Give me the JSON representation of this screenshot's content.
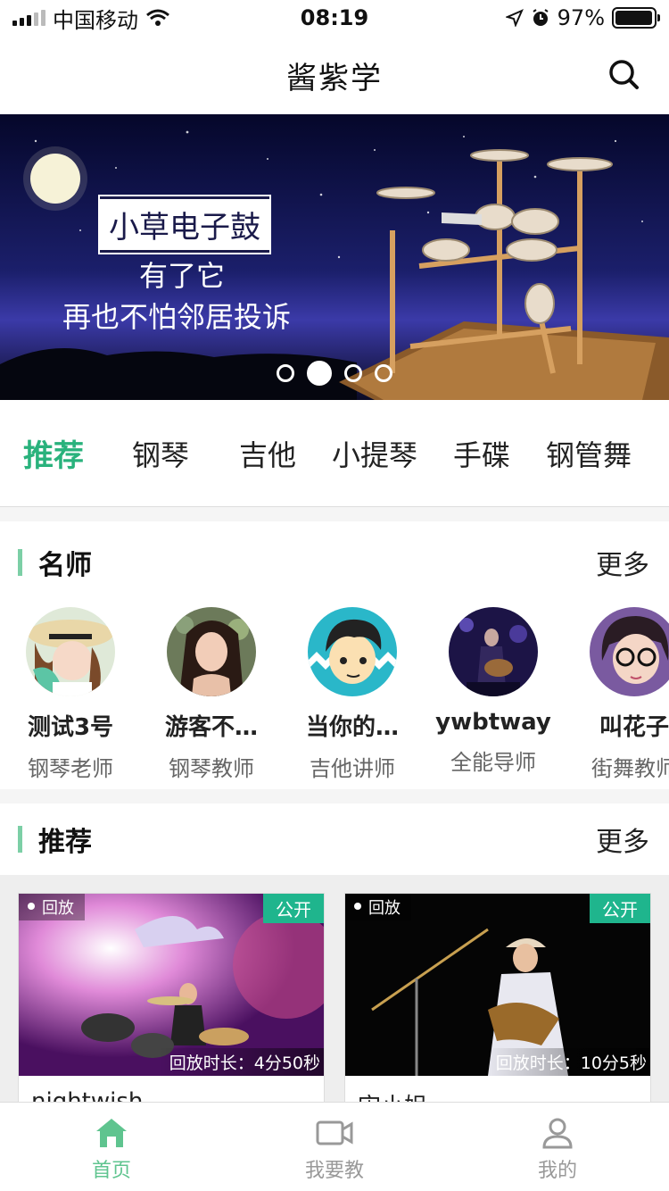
{
  "status_bar": {
    "carrier": "中国移动",
    "time": "08:19",
    "battery": "97%",
    "battery_level": 0.97,
    "icons": [
      "signal-icon",
      "wifi-icon",
      "location-icon",
      "alarm-icon",
      "battery-icon"
    ]
  },
  "header": {
    "title": "酱紫学",
    "search_icon": "search-icon"
  },
  "banner": {
    "tag": "小草电子鼓",
    "line1": "有了它",
    "line2": "再也不怕邻居投诉",
    "slide_count": 4,
    "active_slide": 2
  },
  "categories": [
    {
      "label": "推荐",
      "active": true
    },
    {
      "label": "钢琴",
      "active": false
    },
    {
      "label": "吉他",
      "active": false
    },
    {
      "label": "小提琴",
      "active": false
    },
    {
      "label": "手碟",
      "active": false
    },
    {
      "label": "钢管舞",
      "active": false
    }
  ],
  "teachers_section": {
    "title": "名师",
    "more": "更多",
    "items": [
      {
        "name": "测试3号",
        "role": "钢琴老师"
      },
      {
        "name": "游客不…",
        "role": "钢琴教师"
      },
      {
        "name": "当你的…",
        "role": "吉他讲师"
      },
      {
        "name": "ywbtway",
        "role": "全能导师"
      },
      {
        "name": "叫花子",
        "role": "街舞教师"
      }
    ]
  },
  "recommend_section": {
    "title": "推荐",
    "more": "更多",
    "items": [
      {
        "replay": "回放",
        "visibility": "公开",
        "duration": "回放时长：4分50秒",
        "title": "nightwish"
      },
      {
        "replay": "回放",
        "visibility": "公开",
        "duration": "回放时长：10分5秒",
        "title": "宋小姐"
      }
    ]
  },
  "tab_bar": {
    "items": [
      {
        "label": "首页",
        "icon": "home-icon",
        "active": true
      },
      {
        "label": "我要教",
        "icon": "video-camera-icon",
        "active": false
      },
      {
        "label": "我的",
        "icon": "user-icon",
        "active": false
      }
    ]
  },
  "colors": {
    "accent": "#29b27c",
    "badge": "#1fb58d",
    "section_bar": "#7ccfa6"
  }
}
